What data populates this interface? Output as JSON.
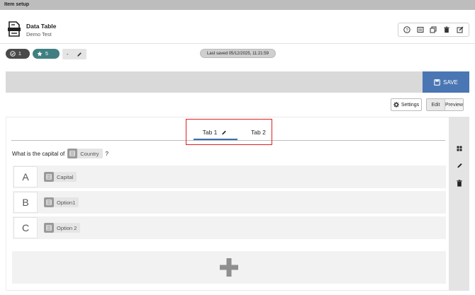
{
  "window": {
    "title": "Item setup"
  },
  "header": {
    "title": "Data Table",
    "subtitle": "Demo Test",
    "tools": [
      "help-icon",
      "preview-icon",
      "copy-icon",
      "trash-icon",
      "edit-icon"
    ]
  },
  "status": {
    "check_count": "1",
    "star_count": "5",
    "edit_label": "-",
    "last_saved": "Last saved 05/12/2025, 11:21:59"
  },
  "toolbar": {
    "save_label": "SAVE",
    "settings_label": "Settings",
    "mode_edit": "Edit",
    "mode_preview": "Preview"
  },
  "tabs": [
    {
      "label": "Tab 1",
      "active": true
    },
    {
      "label": "Tab 2",
      "active": false
    }
  ],
  "question": {
    "prefix": "What is the capital of",
    "token": "Country",
    "suffix": "?"
  },
  "answers": [
    {
      "letter": "A",
      "value": "Capital"
    },
    {
      "letter": "B",
      "value": "Option1"
    },
    {
      "letter": "C",
      "value": "Option 2"
    }
  ],
  "colors": {
    "accent": "#4a76b3",
    "tab_underline": "#3c6faf",
    "highlight": "#e02020",
    "teal_badge": "#3f7f82"
  }
}
